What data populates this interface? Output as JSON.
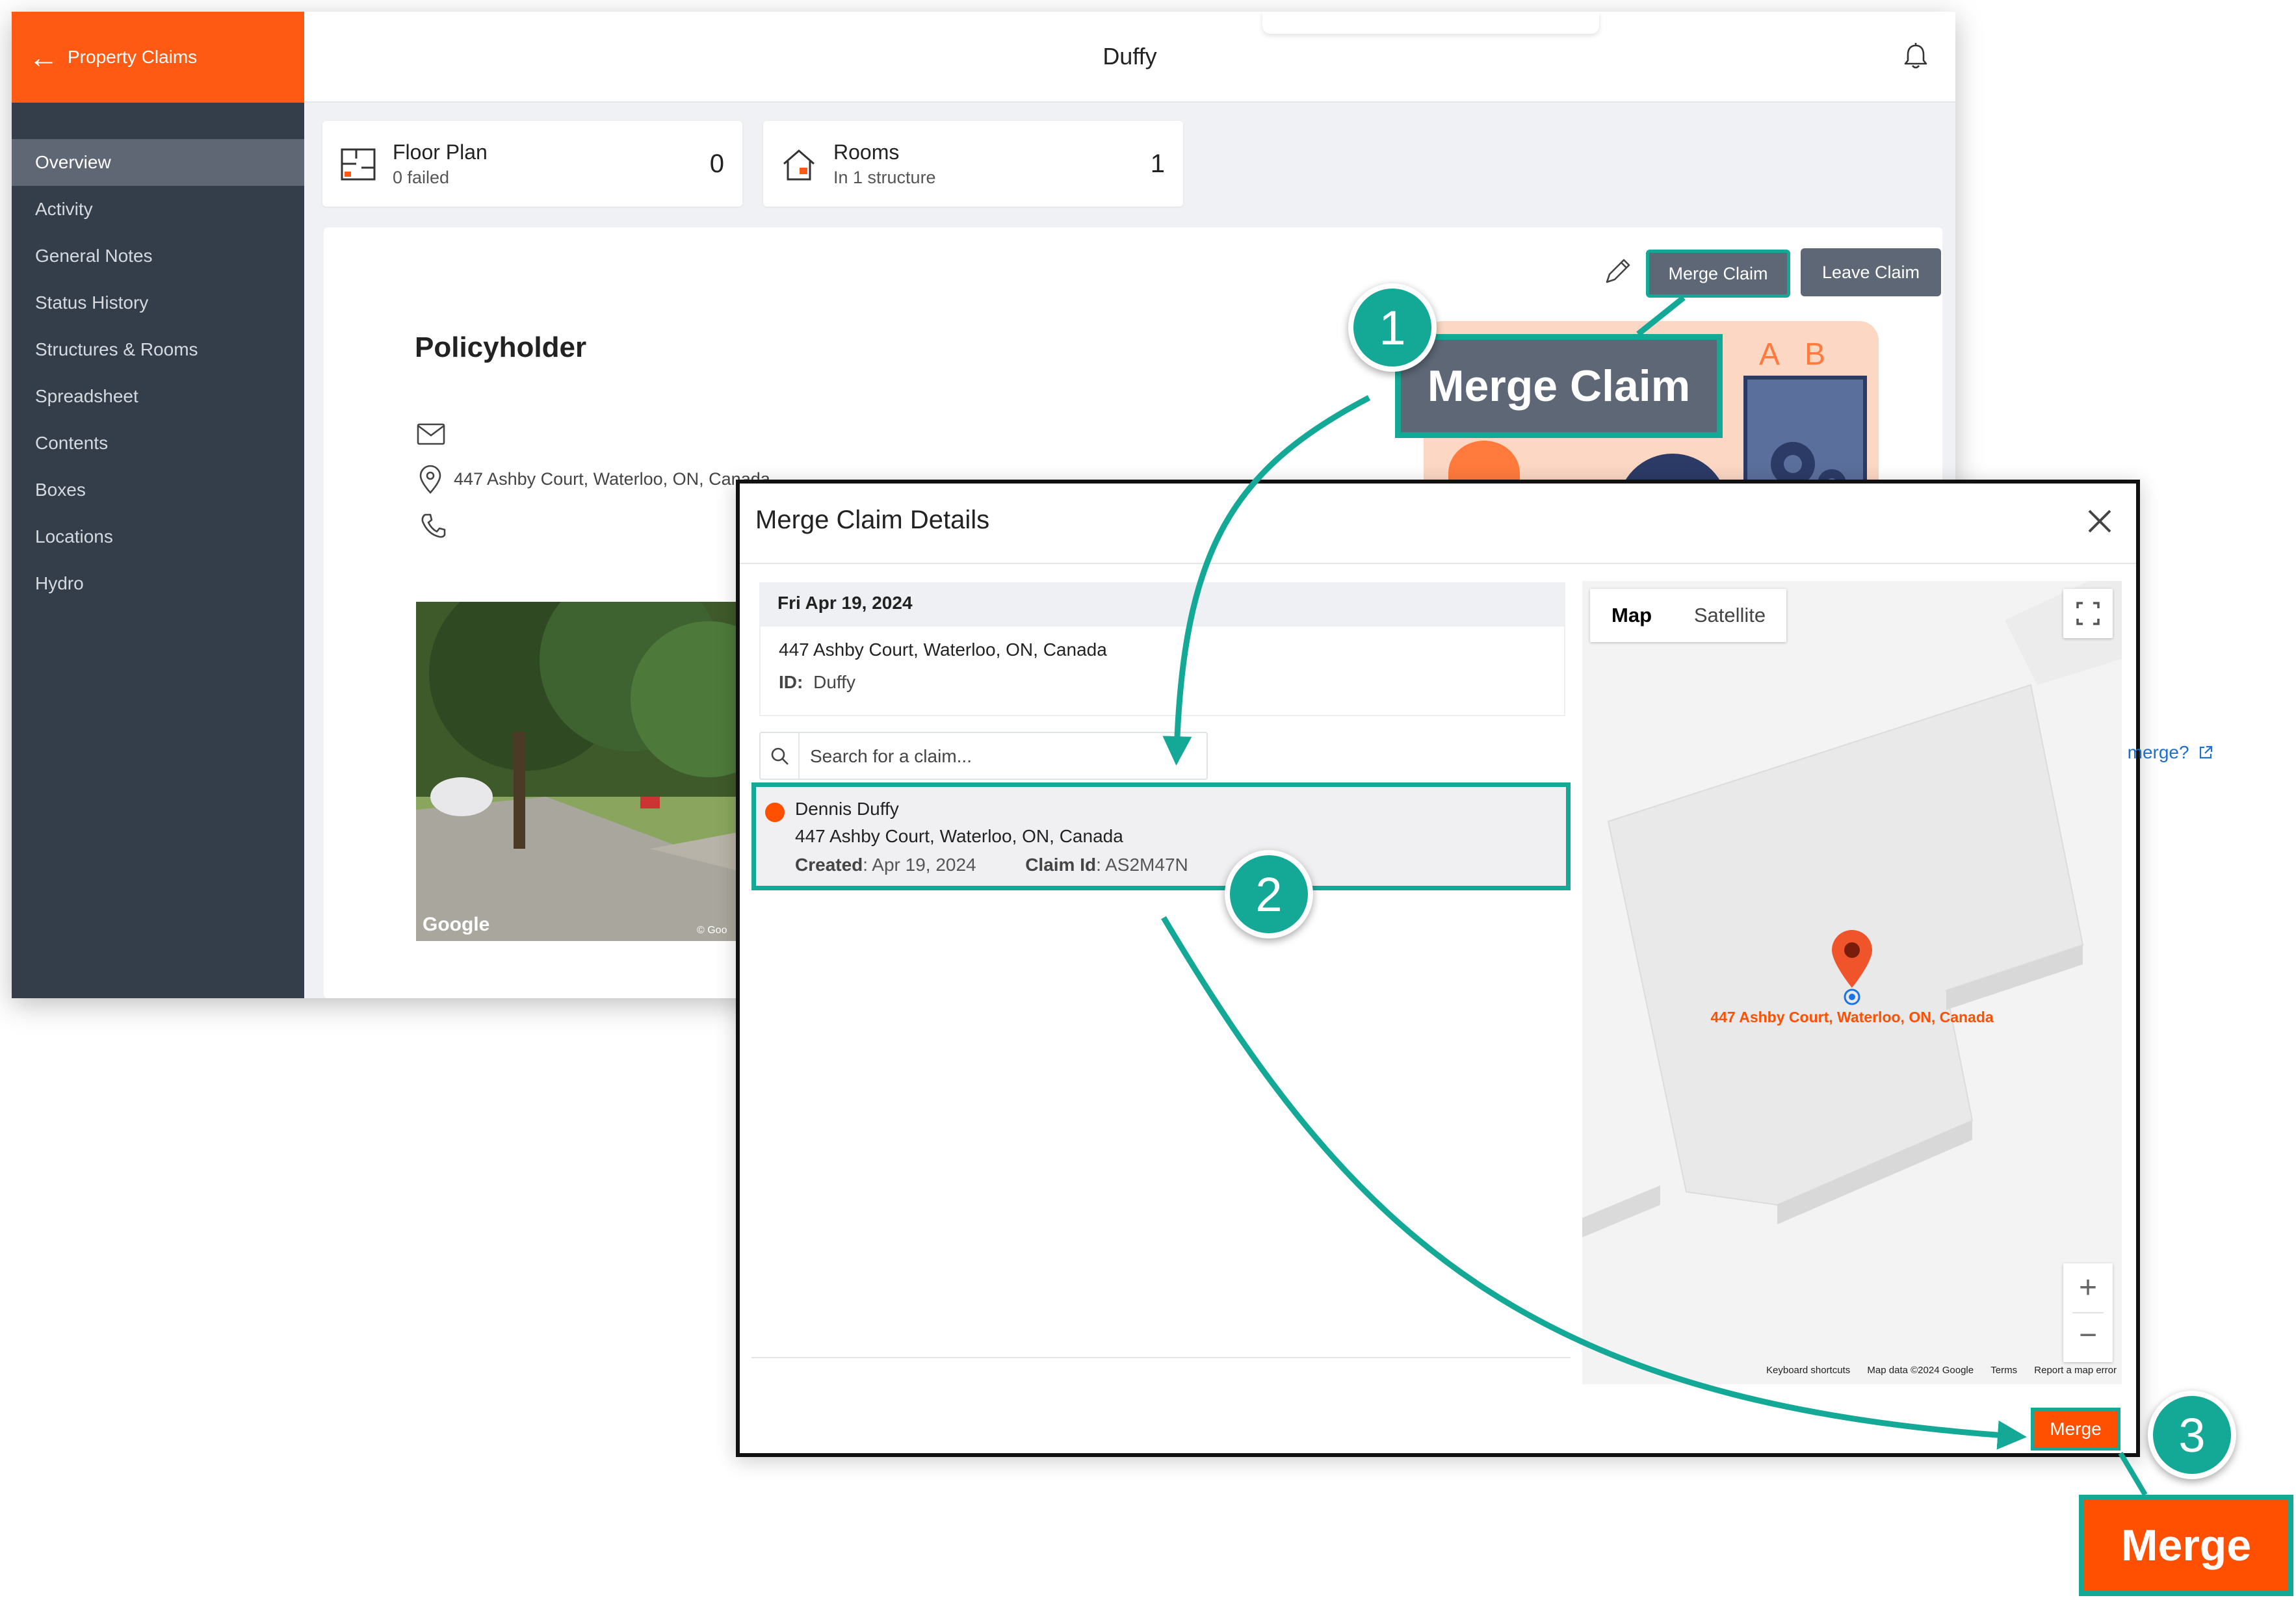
{
  "app": {
    "back_label": "Property Claims",
    "title": "Duffy",
    "sidebar": {
      "items": [
        {
          "label": "Overview",
          "active": true
        },
        {
          "label": "Activity"
        },
        {
          "label": "General Notes"
        },
        {
          "label": "Status History"
        },
        {
          "label": "Structures & Rooms"
        },
        {
          "label": "Spreadsheet"
        },
        {
          "label": "Contents"
        },
        {
          "label": "Boxes"
        },
        {
          "label": "Locations"
        },
        {
          "label": "Hydro"
        }
      ]
    },
    "cards": [
      {
        "name": "Floor Plan",
        "sub": "0 failed",
        "value": "0",
        "icon": "floor-plan-icon"
      },
      {
        "name": "Rooms",
        "sub": "In 1 structure",
        "value": "1",
        "icon": "house-icon"
      }
    ],
    "actions": {
      "merge": "Merge Claim",
      "leave": "Leave Claim"
    },
    "policyholder": {
      "title": "Policyholder",
      "address": "447 Ashby Court, Waterloo, ON, Canada"
    },
    "illustration_letters": [
      "A",
      "B"
    ],
    "photo_watermark": "Google",
    "photo_copyright": "© Goo"
  },
  "modal": {
    "title": "Merge Claim Details",
    "claim": {
      "date": "Fri Apr 19, 2024",
      "address": "447 Ashby Court, Waterloo, ON, Canada",
      "id_label": "ID:",
      "id_value": "Duffy"
    },
    "search": {
      "placeholder": "Search for a claim..."
    },
    "help_link": "What happens when I merge?",
    "result": {
      "name": "Dennis Duffy",
      "address": "447 Ashby Court, Waterloo, ON, Canada",
      "created_label": "Created",
      "created_value": ": Apr 19, 2024",
      "claim_id_label": "Claim Id",
      "claim_id_value": ": AS2M47N"
    },
    "map": {
      "tab_map": "Map",
      "tab_satellite": "Satellite",
      "marker_label": "447 Ashby Court, Waterloo, ON, Canada",
      "attribution": [
        "Keyboard shortcuts",
        "Map data ©2024 Google",
        "Terms",
        "Report a map error"
      ]
    },
    "merge_button": "Merge"
  },
  "callouts": {
    "step1": "1",
    "step2": "2",
    "step3": "3",
    "merge_claim_label": "Merge Claim",
    "merge_label": "Merge"
  },
  "colors": {
    "brand": "#ff5a14",
    "sidebar": "#343d4a",
    "callout": "#14a896",
    "action_button": "#5d6775"
  }
}
